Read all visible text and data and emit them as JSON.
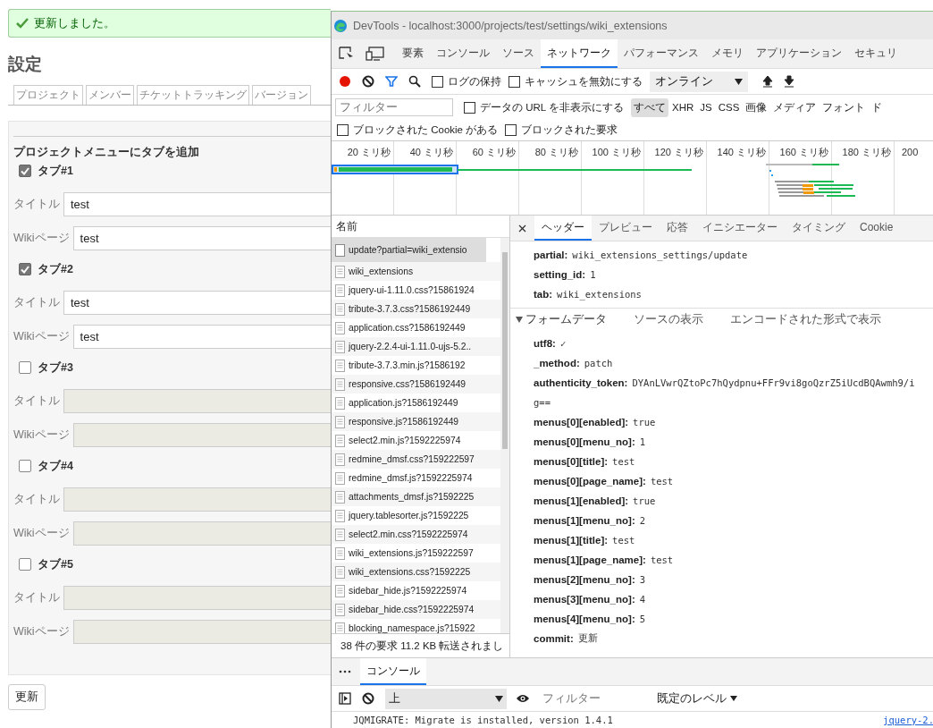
{
  "page": {
    "flash": "更新しました。",
    "heading": "設定",
    "tabs": [
      "プロジェクト",
      "メンバー",
      "チケットトラッキング",
      "バージョン"
    ],
    "section_title": "プロジェクトメニューにタブを追加",
    "menu_tabs": [
      {
        "label": "タブ#1",
        "checked": true,
        "title_label": "タイトル",
        "title": "test",
        "page_label": "Wikiページ",
        "page": "test"
      },
      {
        "label": "タブ#2",
        "checked": true,
        "title_label": "タイトル",
        "title": "test",
        "page_label": "Wikiページ",
        "page": "test"
      },
      {
        "label": "タブ#3",
        "checked": false,
        "title_label": "タイトル",
        "page_label": "Wikiページ"
      },
      {
        "label": "タブ#4",
        "checked": false,
        "title_label": "タイトル",
        "page_label": "Wikiページ"
      },
      {
        "label": "タブ#5",
        "checked": false,
        "title_label": "タイトル",
        "page_label": "Wikiページ"
      }
    ],
    "submit": "更新"
  },
  "devtools": {
    "title": "DevTools - localhost:3000/projects/test/settings/wiki_extensions",
    "tool_tabs": [
      {
        "label": "要素",
        "selected": false
      },
      {
        "label": "コンソール",
        "selected": false
      },
      {
        "label": "ソース",
        "selected": false
      },
      {
        "label": "ネットワーク",
        "selected": true
      },
      {
        "label": "パフォーマンス",
        "selected": false
      },
      {
        "label": "メモリ",
        "selected": false
      },
      {
        "label": "アプリケーション",
        "selected": false
      },
      {
        "label": "セキュリ",
        "selected": false
      }
    ],
    "recording": true,
    "filter_active": true,
    "preserve_log": {
      "label": "ログの保持",
      "checked": false
    },
    "disable_cache": {
      "label": "キャッシュを無効にする",
      "checked": false
    },
    "throttle": "オンライン",
    "filter_placeholder": "フィルター",
    "hide_data_urls": {
      "label": "データの URL を非表示にする",
      "checked": false
    },
    "type_filters": [
      {
        "label": "すべて",
        "selected": true
      },
      {
        "label": "XHR",
        "selected": false
      },
      {
        "label": "JS",
        "selected": false
      },
      {
        "label": "CSS",
        "selected": false
      },
      {
        "label": "画像",
        "selected": false
      },
      {
        "label": "メディア",
        "selected": false
      },
      {
        "label": "フォント",
        "selected": false
      },
      {
        "label": "ド",
        "selected": false
      }
    ],
    "blocked_cookies": {
      "label": "ブロックされた Cookie がある",
      "checked": false
    },
    "blocked_requests": {
      "label": "ブロックされた要求",
      "checked": false
    },
    "timeline_ticks": [
      "20 ミリ秒",
      "40 ミリ秒",
      "60 ミリ秒",
      "80 ミリ秒",
      "100 ミリ秒",
      "120 ミリ秒",
      "140 ミリ秒",
      "160 ミリ秒",
      "180 ミリ秒",
      "200"
    ],
    "requests_header": "名前",
    "requests": [
      {
        "name": "update?partial=wiki_extensio",
        "selected": true
      },
      {
        "name": "wiki_extensions",
        "selected": false
      },
      {
        "name": "jquery-ui-1.11.0.css?15861924",
        "selected": false
      },
      {
        "name": "tribute-3.7.3.css?1586192449",
        "selected": false
      },
      {
        "name": "application.css?1586192449",
        "selected": false
      },
      {
        "name": "jquery-2.2.4-ui-1.11.0-ujs-5.2..",
        "selected": false
      },
      {
        "name": "tribute-3.7.3.min.js?1586192",
        "selected": false
      },
      {
        "name": "responsive.css?1586192449",
        "selected": false
      },
      {
        "name": "application.js?1586192449",
        "selected": false
      },
      {
        "name": "responsive.js?1586192449",
        "selected": false
      },
      {
        "name": "select2.min.js?1592225974",
        "selected": false
      },
      {
        "name": "redmine_dmsf.css?159222597",
        "selected": false
      },
      {
        "name": "redmine_dmsf.js?1592225974",
        "selected": false
      },
      {
        "name": "attachments_dmsf.js?1592225",
        "selected": false
      },
      {
        "name": "jquery.tablesorter.js?1592225",
        "selected": false
      },
      {
        "name": "select2.min.css?1592225974",
        "selected": false
      },
      {
        "name": "wiki_extensions.js?159222597",
        "selected": false
      },
      {
        "name": "wiki_extensions.css?1592225",
        "selected": false
      },
      {
        "name": "sidebar_hide.js?1592225974",
        "selected": false
      },
      {
        "name": "sidebar_hide.css?1592225974",
        "selected": false
      },
      {
        "name": "blocking_namespace.js?15922",
        "selected": false
      }
    ],
    "summary": "38 件の要求  11.2 KB 転送されまし",
    "detail_tabs": [
      {
        "label": "ヘッダー",
        "selected": true
      },
      {
        "label": "プレビュー",
        "selected": false
      },
      {
        "label": "応答",
        "selected": false
      },
      {
        "label": "イニシエーター",
        "selected": false
      },
      {
        "label": "タイミング",
        "selected": false
      },
      {
        "label": "Cookie",
        "selected": false
      }
    ],
    "query_params": [
      {
        "key": "partial:",
        "value": "wiki_extensions_settings/update"
      },
      {
        "key": "setting_id:",
        "value": "1"
      },
      {
        "key": "tab:",
        "value": "wiki_extensions"
      }
    ],
    "form_data": {
      "title": "フォームデータ",
      "expanded": true,
      "links": [
        "ソースの表示",
        "エンコードされた形式で表示"
      ],
      "params": [
        {
          "key": "utf8:",
          "value": "✓"
        },
        {
          "key": "_method:",
          "value": "patch"
        },
        {
          "key": "authenticity_token:",
          "value": "DYAnLVwrQZtoPc7hQydpnu+FFr9vi8goQzrZ5iUcdBQAwmh9/i",
          "continuation": "g=="
        },
        {
          "key": "menus[0][enabled]:",
          "value": "true"
        },
        {
          "key": "menus[0][menu_no]:",
          "value": "1"
        },
        {
          "key": "menus[0][title]:",
          "value": "test"
        },
        {
          "key": "menus[0][page_name]:",
          "value": "test"
        },
        {
          "key": "menus[1][enabled]:",
          "value": "true"
        },
        {
          "key": "menus[1][menu_no]:",
          "value": "2"
        },
        {
          "key": "menus[1][title]:",
          "value": "test"
        },
        {
          "key": "menus[1][page_name]:",
          "value": "test"
        },
        {
          "key": "menus[2][menu_no]:",
          "value": "3"
        },
        {
          "key": "menus[3][menu_no]:",
          "value": "4"
        },
        {
          "key": "menus[4][menu_no]:",
          "value": "5"
        },
        {
          "key": "commit:",
          "value": "更新"
        }
      ]
    },
    "drawer": {
      "tabs": [
        {
          "label": "コンソール",
          "selected": true
        }
      ],
      "context": "上",
      "filter_placeholder": "フィルター",
      "level": "既定のレベル",
      "messages": [
        {
          "text": "JQMIGRATE: Migrate is installed, version 1.4.1",
          "source": "jquery-2."
        }
      ]
    }
  }
}
